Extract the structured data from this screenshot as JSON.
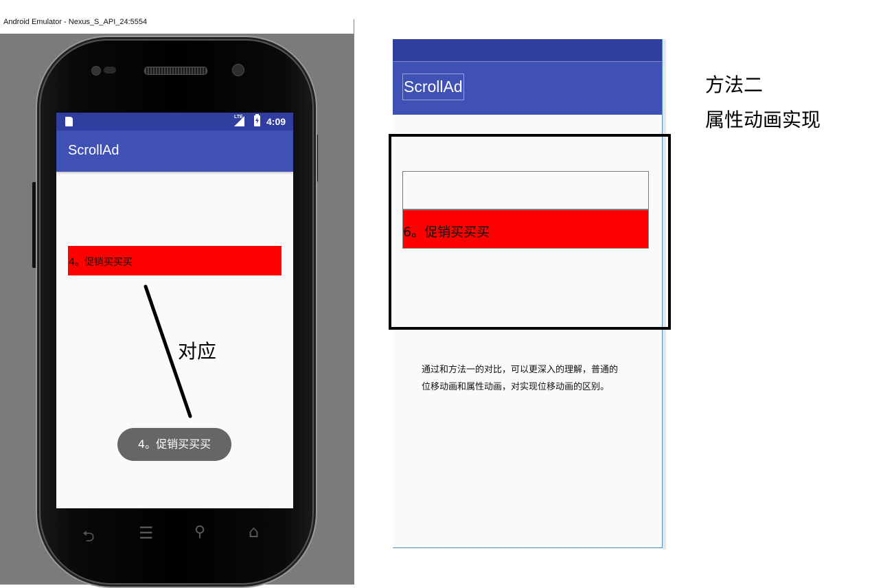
{
  "emulator": {
    "window_title": "Android Emulator - Nexus_S_API_24:5554",
    "status_bar": {
      "network": "LTE",
      "time": "4:09"
    },
    "app_bar": {
      "title": "ScrollAd"
    },
    "ad_banner_text": "4。促销买买买",
    "toast_text": "4。促销买买买",
    "nav_icons": [
      "back-icon",
      "menu-icon",
      "search-icon",
      "home-icon"
    ]
  },
  "annotation": {
    "label": "对应"
  },
  "preview": {
    "app_title": "ScrollAd",
    "ad_banner_text": "6。促销买买买",
    "note": "通过和方法一的对比，可以更深入的理解，普通的位移动画和属性动画，对实现位移动画的区别。"
  },
  "method": {
    "title": "方法二",
    "subtitle": "属性动画实现"
  },
  "colors": {
    "status_bar": "#303f9f",
    "app_bar": "#3f51b5",
    "ad_red": "#ff0000",
    "toast": "#666666",
    "emulator_bg": "#7b7b7b"
  }
}
